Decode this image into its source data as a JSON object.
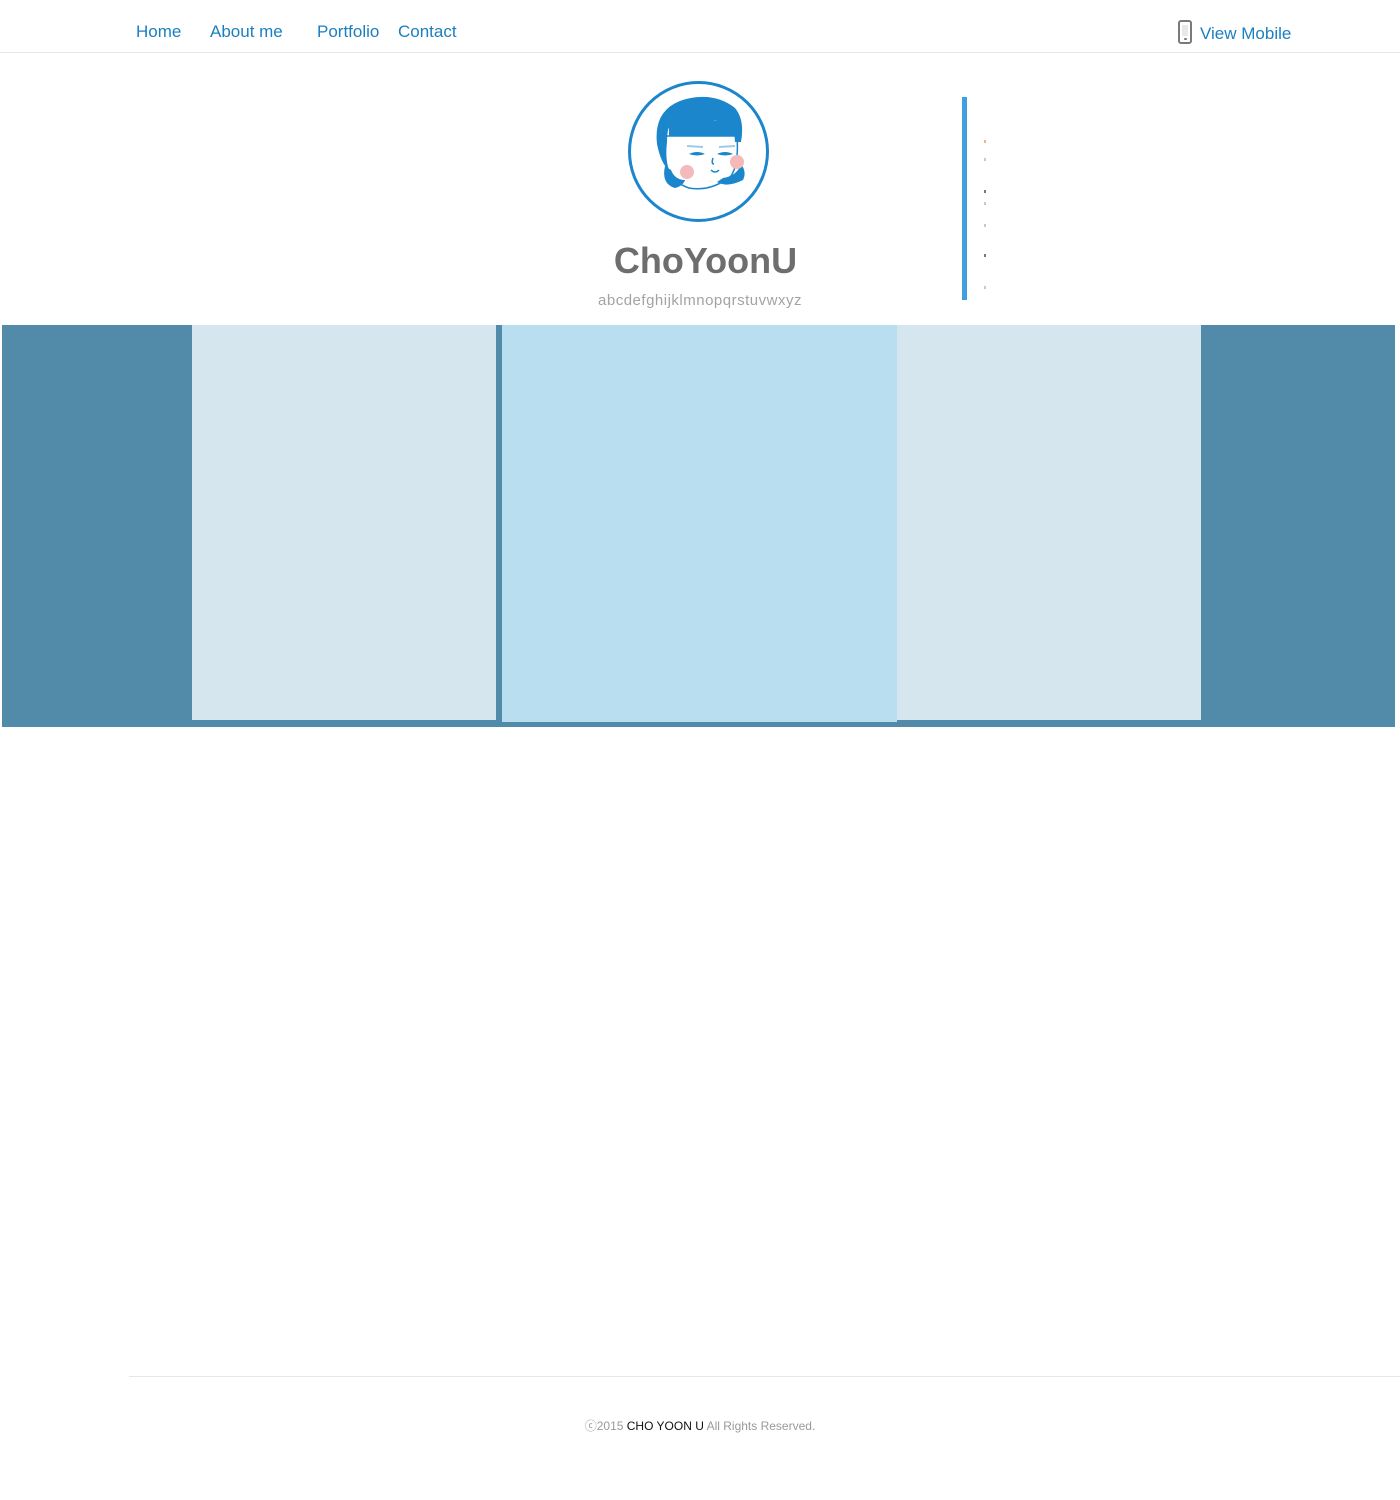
{
  "nav": {
    "items": [
      "Home",
      "About me",
      "Portfolio",
      "Contact"
    ],
    "view_mobile_label": "View Mobile",
    "view_mobile_icon": "mobile-phone-icon",
    "link_color": "#1b7fbf"
  },
  "header": {
    "title": "ChoYoonU",
    "subtitle": "abcdefghijklmnopqrstuvwxyz",
    "avatar_icon": "girl-face-illustration",
    "accent_color": "#1b86cc"
  },
  "slider": {
    "background_color": "#528ba9",
    "side_panel_color": "#d6e6ef",
    "center_panel_color": "#b8def0"
  },
  "footer": {
    "copyright": "ⓒ2015",
    "owner": "CHO YOON U",
    "rights": "All Rights Reserved."
  }
}
